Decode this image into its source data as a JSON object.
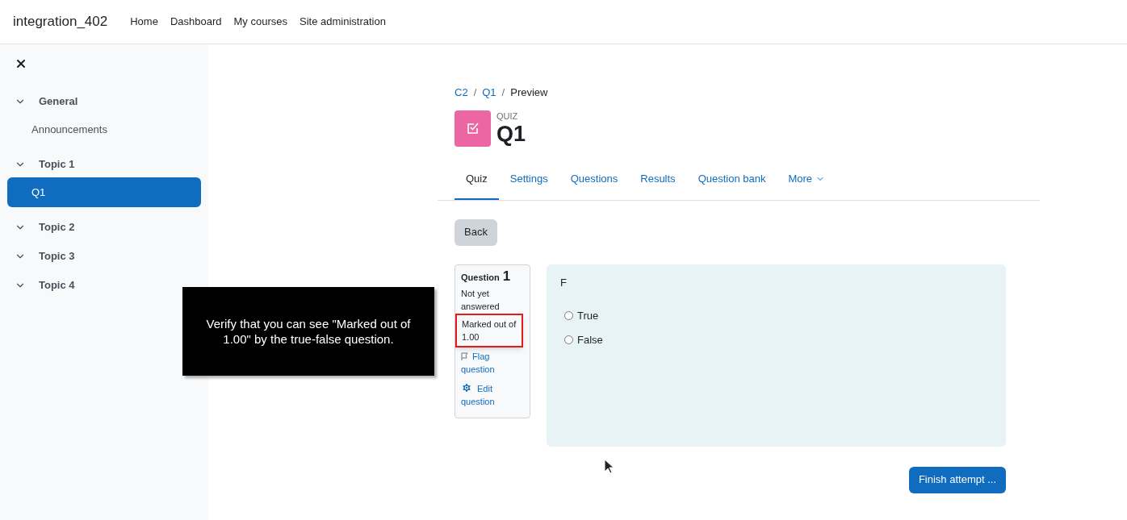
{
  "navbar": {
    "site_name": "integration_402",
    "links": [
      "Home",
      "Dashboard",
      "My courses",
      "Site administration"
    ]
  },
  "sidebar": {
    "sections": [
      {
        "title": "General",
        "items": [
          {
            "label": "Announcements",
            "selected": false
          }
        ]
      },
      {
        "title": "Topic 1",
        "items": [
          {
            "label": "Q1",
            "selected": true
          }
        ]
      },
      {
        "title": "Topic 2"
      },
      {
        "title": "Topic 3"
      },
      {
        "title": "Topic 4"
      }
    ]
  },
  "breadcrumb": [
    {
      "label": "C2",
      "kind": "link"
    },
    {
      "label": "/",
      "kind": "separator"
    },
    {
      "label": "Q1",
      "kind": "link"
    },
    {
      "label": "/",
      "kind": "separator"
    },
    {
      "label": "Preview",
      "kind": "current"
    }
  ],
  "header": {
    "kind_label": "QUIZ",
    "title": "Q1"
  },
  "tabs": [
    {
      "label": "Quiz",
      "selected": true,
      "dropdown": false
    },
    {
      "label": "Settings",
      "selected": false,
      "dropdown": false
    },
    {
      "label": "Questions",
      "selected": false,
      "dropdown": false
    },
    {
      "label": "Results",
      "selected": false,
      "dropdown": false
    },
    {
      "label": "Question bank",
      "selected": false,
      "dropdown": false
    },
    {
      "label": "More",
      "selected": false,
      "dropdown": true
    }
  ],
  "back_button": "Back",
  "question_info": {
    "label": "Question",
    "number": "1",
    "status": "Not yet answered",
    "mark": "Marked out of 1.00",
    "mark_highlighted": true,
    "flag_link": "Flag question",
    "edit_link": "Edit question"
  },
  "question": {
    "text": "F",
    "options": [
      {
        "label": "True",
        "checked": false
      },
      {
        "label": "False",
        "checked": false
      }
    ]
  },
  "finish_button": "Finish attempt ...",
  "tooltip": "Verify that you can see \"Marked out of 1.00\" by the true-false question."
}
